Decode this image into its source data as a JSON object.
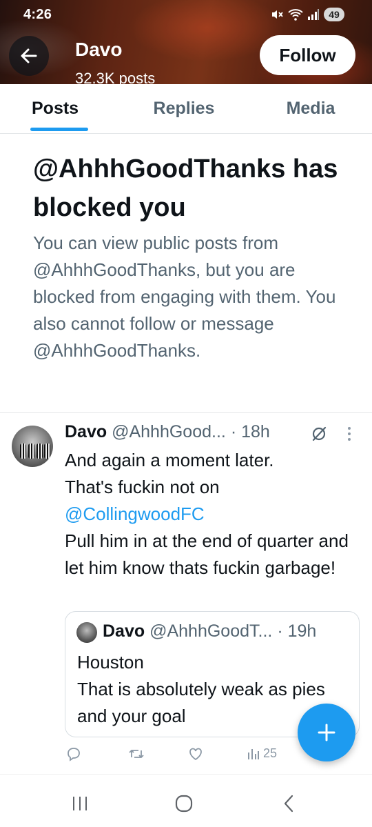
{
  "status_bar": {
    "time": "4:26",
    "battery": "49"
  },
  "header": {
    "name": "Davo",
    "post_count": "32.3K posts",
    "follow_label": "Follow"
  },
  "tabs": [
    {
      "label": "Posts",
      "active": true
    },
    {
      "label": "Replies",
      "active": false
    },
    {
      "label": "Media",
      "active": false
    }
  ],
  "blocked": {
    "title": "@AhhhGoodThanks has blocked you",
    "description": "You can view public posts from @AhhhGoodThanks, but you are blocked from engaging with them. You also cannot follow or message @AhhhGoodThanks."
  },
  "tweet": {
    "name": "Davo",
    "handle": "@AhhhGood...",
    "time": "· 18h",
    "line1": "And again a moment later.",
    "line2": "That's fuckin not on",
    "mention": "@CollingwoodFC",
    "line3": "Pull him in at the end of quarter and let him know thats fuckin garbage!",
    "quote": {
      "name": "Davo",
      "handle": "@AhhhGoodT...",
      "time": "· 19h",
      "line1": "Houston",
      "line2": "That is absolutely weak as pies and your goal"
    },
    "views": "25"
  },
  "icons": {
    "back": "arrow-left-icon",
    "grok": "grok-icon",
    "more": "more-vertical-icon",
    "reply": "reply-icon",
    "retweet": "retweet-icon",
    "like": "heart-icon",
    "views": "views-icon",
    "compose": "plus-icon"
  },
  "colors": {
    "accent": "#1d9bf0",
    "text": "#0f1419",
    "secondary": "#536471"
  }
}
